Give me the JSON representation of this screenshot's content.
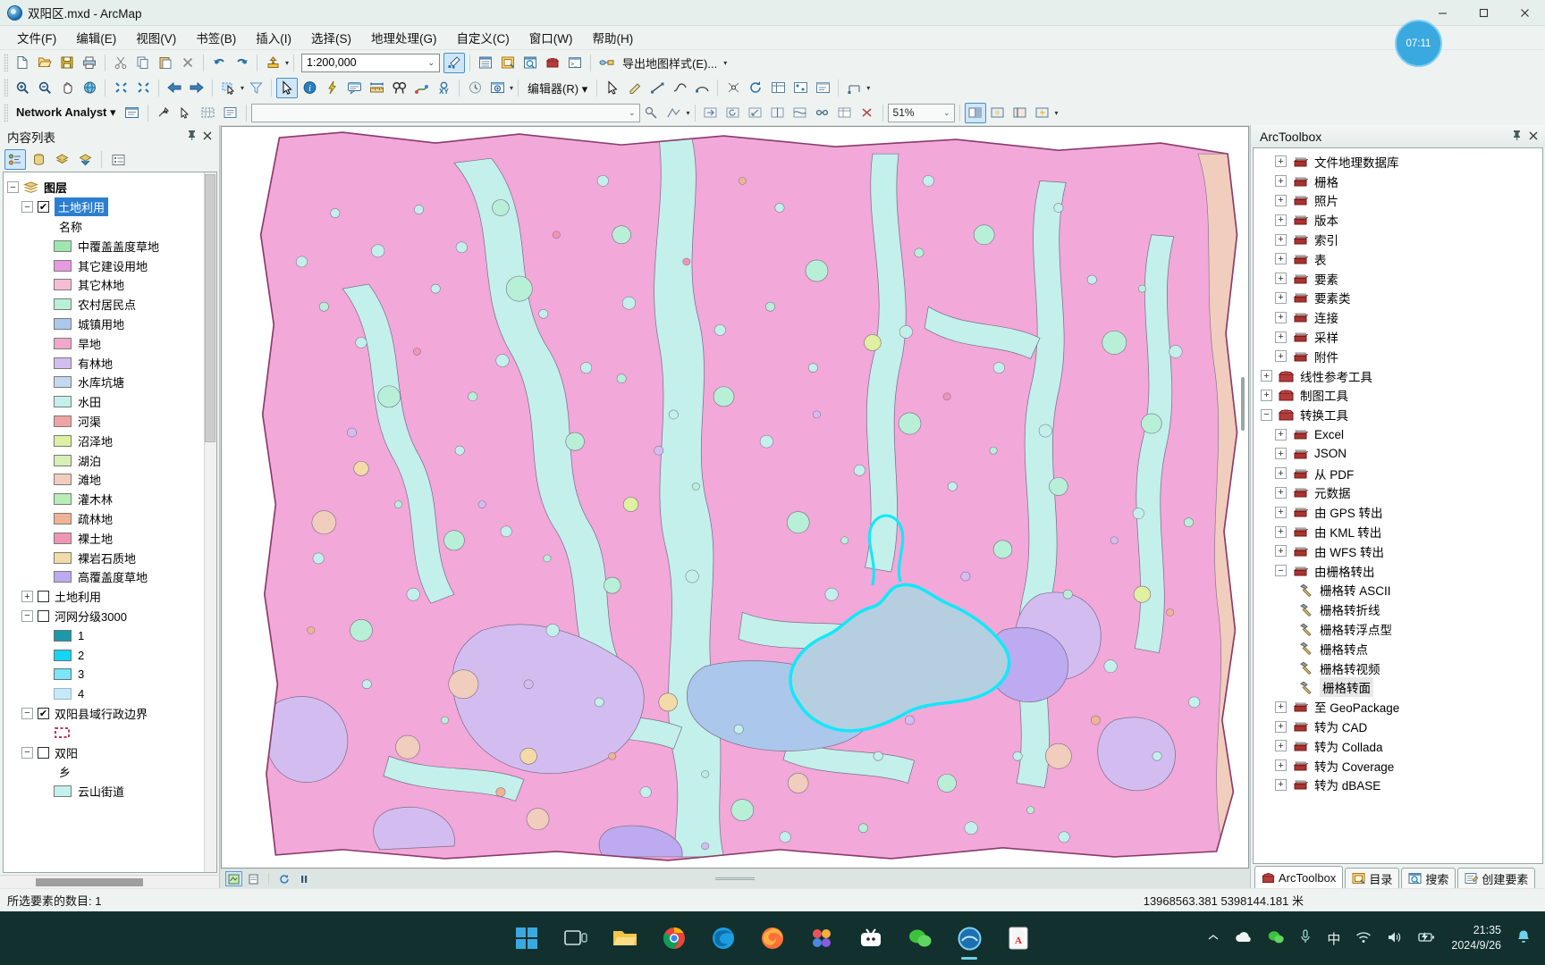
{
  "window": {
    "title": "双阳区.mxd - ArcMap",
    "minimize": "−",
    "maximize": "▢",
    "close": "✕"
  },
  "menu": [
    "文件(F)",
    "编辑(E)",
    "视图(V)",
    "书签(B)",
    "插入(I)",
    "选择(S)",
    "地理处理(G)",
    "自定义(C)",
    "窗口(W)",
    "帮助(H)"
  ],
  "toolbar_standard": {
    "scale_value": "1:200,000",
    "export_label": "导出地图样式(E)..."
  },
  "toolbar_tools": {
    "editor_label": "编辑器(R) ▾"
  },
  "toolbar_network": {
    "label": "Network Analyst ▾",
    "zoom_value": "51%"
  },
  "toc": {
    "title": "内容列表",
    "pin": "📌",
    "close": "✕",
    "root": "图层",
    "active_layer": "土地利用",
    "field_header": "名称",
    "legend": [
      {
        "label": "中覆盖盖度草地",
        "color": "#9ee6b0"
      },
      {
        "label": "其它建设用地",
        "color": "#e89ae0"
      },
      {
        "label": "其它林地",
        "color": "#f5bcd4"
      },
      {
        "label": "农村居民点",
        "color": "#b7f0d6"
      },
      {
        "label": "城镇用地",
        "color": "#abc7ec"
      },
      {
        "label": "旱地",
        "color": "#f2a8c8"
      },
      {
        "label": "有林地",
        "color": "#d3bdf0"
      },
      {
        "label": "水库坑塘",
        "color": "#c5d8f2"
      },
      {
        "label": "水田",
        "color": "#c3f0ea"
      },
      {
        "label": "河渠",
        "color": "#efa3a5"
      },
      {
        "label": "沼泽地",
        "color": "#dff0a0"
      },
      {
        "label": "湖泊",
        "color": "#d6f0b5"
      },
      {
        "label": "滩地",
        "color": "#f0cdbc"
      },
      {
        "label": "灌木林",
        "color": "#b7eeb5"
      },
      {
        "label": "疏林地",
        "color": "#f0b394"
      },
      {
        "label": "裸土地",
        "color": "#f095b5"
      },
      {
        "label": "裸岩石质地",
        "color": "#f2dba6"
      },
      {
        "label": "高覆盖度草地",
        "color": "#bdaaf0"
      }
    ],
    "layer2": "土地利用",
    "layer3": "河网分级3000",
    "stream_classes": [
      {
        "label": "1",
        "color": "#1a9aa8",
        "frame": "#6f6f6f"
      },
      {
        "label": "2",
        "color": "#13d6f5",
        "frame": "#6f6f6f"
      },
      {
        "label": "3",
        "color": "#7ae6f7",
        "frame": "#6f6f6f"
      },
      {
        "label": "4",
        "color": "#c6e9f7",
        "frame": "#9ab6c4"
      }
    ],
    "layer4": "双阳县域行政边界",
    "layer5": "双阳",
    "layer5_field": "乡",
    "layer5_item": "云山街道"
  },
  "arctoolbox": {
    "title": "ArcToolbox",
    "items": [
      {
        "label": "文件地理数据库",
        "level": 2,
        "icon": "toolset",
        "expander": "+"
      },
      {
        "label": "栅格",
        "level": 2,
        "icon": "toolset",
        "expander": "+"
      },
      {
        "label": "照片",
        "level": 2,
        "icon": "toolset",
        "expander": "+"
      },
      {
        "label": "版本",
        "level": 2,
        "icon": "toolset",
        "expander": "+"
      },
      {
        "label": "索引",
        "level": 2,
        "icon": "toolset",
        "expander": "+"
      },
      {
        "label": "表",
        "level": 2,
        "icon": "toolset",
        "expander": "+"
      },
      {
        "label": "要素",
        "level": 2,
        "icon": "toolset",
        "expander": "+"
      },
      {
        "label": "要素类",
        "level": 2,
        "icon": "toolset",
        "expander": "+"
      },
      {
        "label": "连接",
        "level": 2,
        "icon": "toolset",
        "expander": "+"
      },
      {
        "label": "采样",
        "level": 2,
        "icon": "toolset",
        "expander": "+"
      },
      {
        "label": "附件",
        "level": 2,
        "icon": "toolset",
        "expander": "+"
      },
      {
        "label": "线性参考工具",
        "level": 1,
        "icon": "toolbox",
        "expander": "+"
      },
      {
        "label": "制图工具",
        "level": 1,
        "icon": "toolbox",
        "expander": "+"
      },
      {
        "label": "转换工具",
        "level": 1,
        "icon": "toolbox",
        "expander": "−"
      },
      {
        "label": "Excel",
        "level": 2,
        "icon": "toolset",
        "expander": "+"
      },
      {
        "label": "JSON",
        "level": 2,
        "icon": "toolset",
        "expander": "+"
      },
      {
        "label": "从 PDF",
        "level": 2,
        "icon": "toolset",
        "expander": "+"
      },
      {
        "label": "元数据",
        "level": 2,
        "icon": "toolset",
        "expander": "+"
      },
      {
        "label": "由 GPS 转出",
        "level": 2,
        "icon": "toolset",
        "expander": "+"
      },
      {
        "label": "由 KML 转出",
        "level": 2,
        "icon": "toolset",
        "expander": "+"
      },
      {
        "label": "由 WFS 转出",
        "level": 2,
        "icon": "toolset",
        "expander": "+"
      },
      {
        "label": "由栅格转出",
        "level": 2,
        "icon": "toolset",
        "expander": "−"
      },
      {
        "label": "栅格转 ASCII",
        "level": 3,
        "icon": "tool",
        "expander": ""
      },
      {
        "label": "栅格转折线",
        "level": 3,
        "icon": "tool",
        "expander": ""
      },
      {
        "label": "栅格转浮点型",
        "level": 3,
        "icon": "tool",
        "expander": ""
      },
      {
        "label": "栅格转点",
        "level": 3,
        "icon": "tool",
        "expander": ""
      },
      {
        "label": "栅格转视频",
        "level": 3,
        "icon": "tool",
        "expander": ""
      },
      {
        "label": "栅格转面",
        "level": 3,
        "icon": "tool",
        "expander": "",
        "highlight": true
      },
      {
        "label": "至 GeoPackage",
        "level": 2,
        "icon": "toolset",
        "expander": "+"
      },
      {
        "label": "转为 CAD",
        "level": 2,
        "icon": "toolset",
        "expander": "+"
      },
      {
        "label": "转为 Collada",
        "level": 2,
        "icon": "toolset",
        "expander": "+"
      },
      {
        "label": "转为 Coverage",
        "level": 2,
        "icon": "toolset",
        "expander": "+"
      },
      {
        "label": "转为 dBASE",
        "level": 2,
        "icon": "toolset",
        "expander": "+"
      }
    ],
    "tabs": [
      {
        "label": "ArcToolbox",
        "selected": true
      },
      {
        "label": "目录",
        "selected": false
      },
      {
        "label": "搜索",
        "selected": false
      },
      {
        "label": "创建要素",
        "selected": false
      }
    ]
  },
  "statusbar": {
    "selection": "所选要素的数目: 1",
    "coordinates": "13968563.381  5398144.181 米"
  },
  "clock_widget": "07:11",
  "taskbar": {
    "time": "21:35",
    "date": "2024/9/26",
    "ime": "中"
  }
}
